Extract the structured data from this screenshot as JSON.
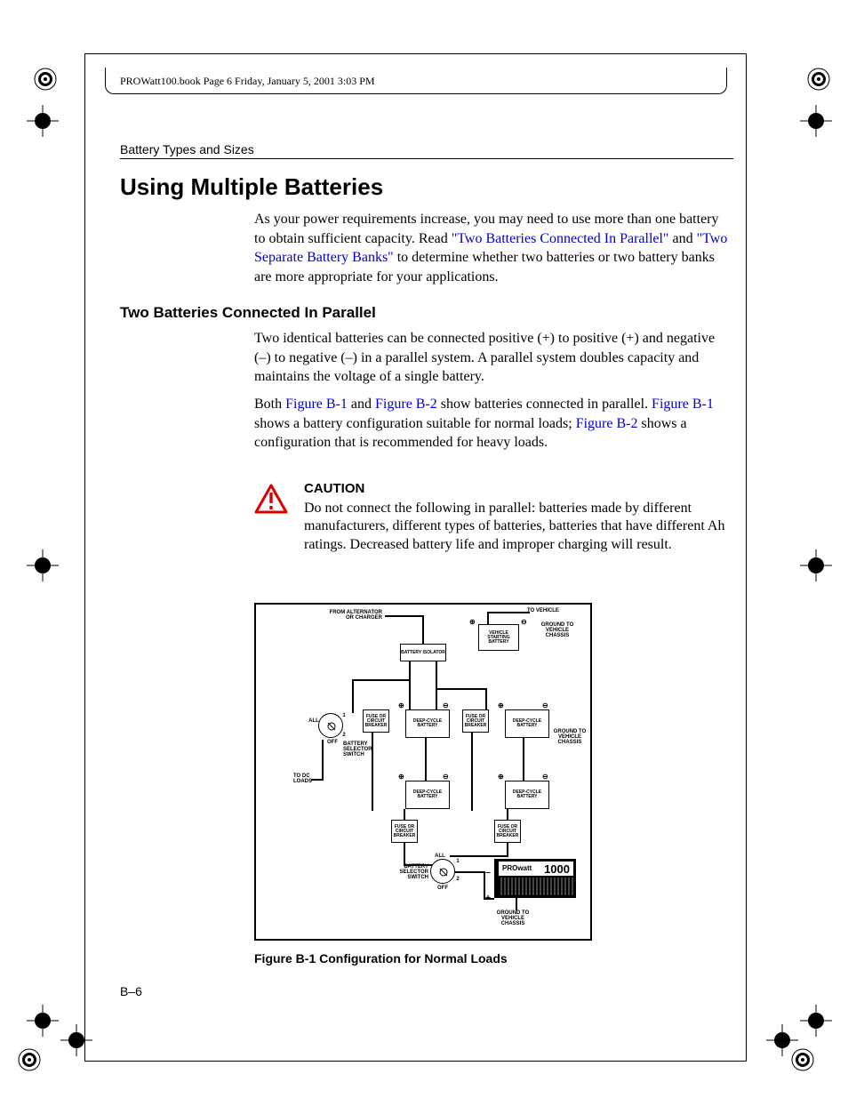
{
  "header_line": "PROWatt100.book  Page 6  Friday, January 5, 2001  3:03 PM",
  "running_head": "Battery Types and Sizes",
  "h1": "Using Multiple Batteries",
  "para1_a": "As your power requirements increase, you may need to use more than one battery to obtain sufficient capacity. Read ",
  "para1_link1": "\"Two Batteries Connected In Parallel\"",
  "para1_b": " and ",
  "para1_link2": "\"Two Separate Battery Banks\"",
  "para1_c": " to determine whether two batteries or two battery banks are more appropriate for your applications.",
  "h2": "Two Batteries Connected In Parallel",
  "para2": "Two identical batteries can be connected positive (+) to positive (+) and negative (–) to negative (–) in a parallel system. A parallel system doubles capacity and maintains the voltage of a single battery.",
  "para3_a": "Both ",
  "para3_link1": "Figure B-1",
  "para3_b": " and ",
  "para3_link2": "Figure B-2",
  "para3_c": " show batteries connected in parallel. ",
  "para3_link3": "Figure B-1",
  "para3_d": " shows a battery configuration suitable for normal loads; ",
  "para3_link4": "Figure B-2",
  "para3_e": " shows a configuration that is recommended for heavy loads.",
  "caution_title": "CAUTION",
  "caution_body": "Do not connect the following in parallel: batteries made by different manufacturers, different types of batteries, batteries that have different Ah ratings. Decreased battery life and improper charging will result.",
  "figure_caption": "Figure B-1   Configuration for Normal Loads",
  "page_num": "B–6",
  "fig": {
    "from_alt": "FROM ALTERNATOR\nOR CHARGER",
    "to_vehicle": "TO VEHICLE",
    "batt_iso": "BATTERY ISOLATOR",
    "veh_start": "VEHICLE\nSTARTING\nBATTERY",
    "gnd_chassis": "GROUND TO\nVEHICLE\nCHASSIS",
    "fuse": "FUSE OR\nCIRCUIT\nBREAKER",
    "deep": "DEEP-CYCLE\nBATTERY",
    "batt_sel": "BATTERY\nSELECTOR\nSWITCH",
    "to_dc": "TO DC\nLOADS",
    "all": "ALL",
    "off": "OFF",
    "prowatt": "PROwatt",
    "model": "1000",
    "one": "1",
    "two": "2",
    "plus": "+",
    "minus": "–"
  }
}
